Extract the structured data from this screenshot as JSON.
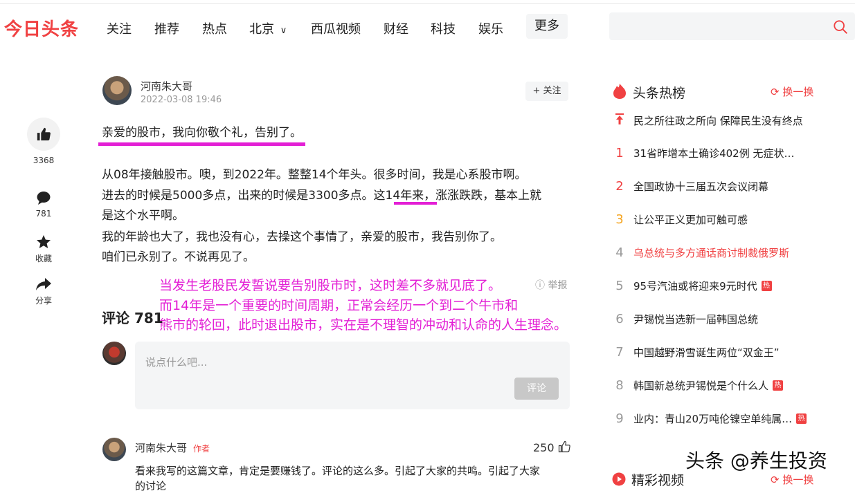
{
  "brand": {
    "logo": "今日头条",
    "accent": "#f04142"
  },
  "nav": {
    "items": [
      "关注",
      "推荐",
      "热点",
      "北京",
      "西瓜视频",
      "财经",
      "科技",
      "娱乐"
    ],
    "more": "更多",
    "search_placeholder": ""
  },
  "sidebar": {
    "like_count": "3368",
    "comment_count": "781",
    "collect_label": "收藏",
    "share_label": "分享"
  },
  "author": {
    "name": "河南朱大哥",
    "time": "2022-03-08 19:46",
    "follow": "+ 关注"
  },
  "article": {
    "title": "亲爱的股市，我向你敬个礼，告别了。",
    "lines": [
      "从08年接触股市。噢，到2022年。整整14个年头。很多时间，我是心系股市啊。",
      "进去的时候是5000多点，出来的时候是3300多点。这14年来，涨涨跌跌，基本上就",
      "是这个水平啊。",
      "我的年龄也大了，我也没有心，去操这个事情了，亲爱的股市，我告别你了。",
      "咱们已永别了。不说再见了。"
    ],
    "report": "举报"
  },
  "annotation": {
    "lines": [
      "当发生老股民发誓说要告别股市时，这时差不多就见底了。",
      "而14年是一个重要的时间周期，正常会经历一个到二个牛市和",
      "熊市的轮回，此时退出股市，实在是不理智的冲动和认命的人生理念。"
    ],
    "color": "#e31fd5"
  },
  "comments": {
    "title": "评论 781",
    "placeholder": "说点什么吧...",
    "submit": "评论",
    "first": {
      "author": "河南朱大哥",
      "tag": "作者",
      "likes": "250",
      "text": "看来我写的这篇文章，肯定是要赚钱了。评论的这么多。引起了大家的共鸣。引起了大家",
      "text2": "的讨论"
    }
  },
  "hot": {
    "title": "头条热榜",
    "refresh": "换一换",
    "items": [
      {
        "rank": "",
        "text": "民之所往政之所向 保障民生没有终点",
        "badge": ""
      },
      {
        "rank": "1",
        "text": "31省昨增本土确诊402例 无症状…",
        "badge": ""
      },
      {
        "rank": "2",
        "text": "全国政协十三届五次会议闭幕",
        "badge": ""
      },
      {
        "rank": "3",
        "text": "让公平正义更加可触可感",
        "badge": ""
      },
      {
        "rank": "4",
        "text": "乌总统与多方通话商讨制裁俄罗斯",
        "badge": ""
      },
      {
        "rank": "5",
        "text": "95号汽油或将迎来9元时代",
        "badge": "热"
      },
      {
        "rank": "6",
        "text": "尹锡悦当选新一届韩国总统",
        "badge": ""
      },
      {
        "rank": "7",
        "text": "中国越野滑雪诞生两位“双金王”",
        "badge": ""
      },
      {
        "rank": "8",
        "text": "韩国新总统尹锡悦是个什么人",
        "badge": "热"
      },
      {
        "rank": "9",
        "text": "业内：青山20万吨伦镍空单纯属…",
        "badge": "热"
      }
    ],
    "rank_colors": [
      "#f04142",
      "#f04142",
      "#f04142",
      "#f5a623",
      "#999999"
    ],
    "visited_color": "#f04142"
  },
  "video": {
    "title": "精彩视频",
    "refresh": "换一换"
  },
  "watermark": "头条 @养生投资"
}
